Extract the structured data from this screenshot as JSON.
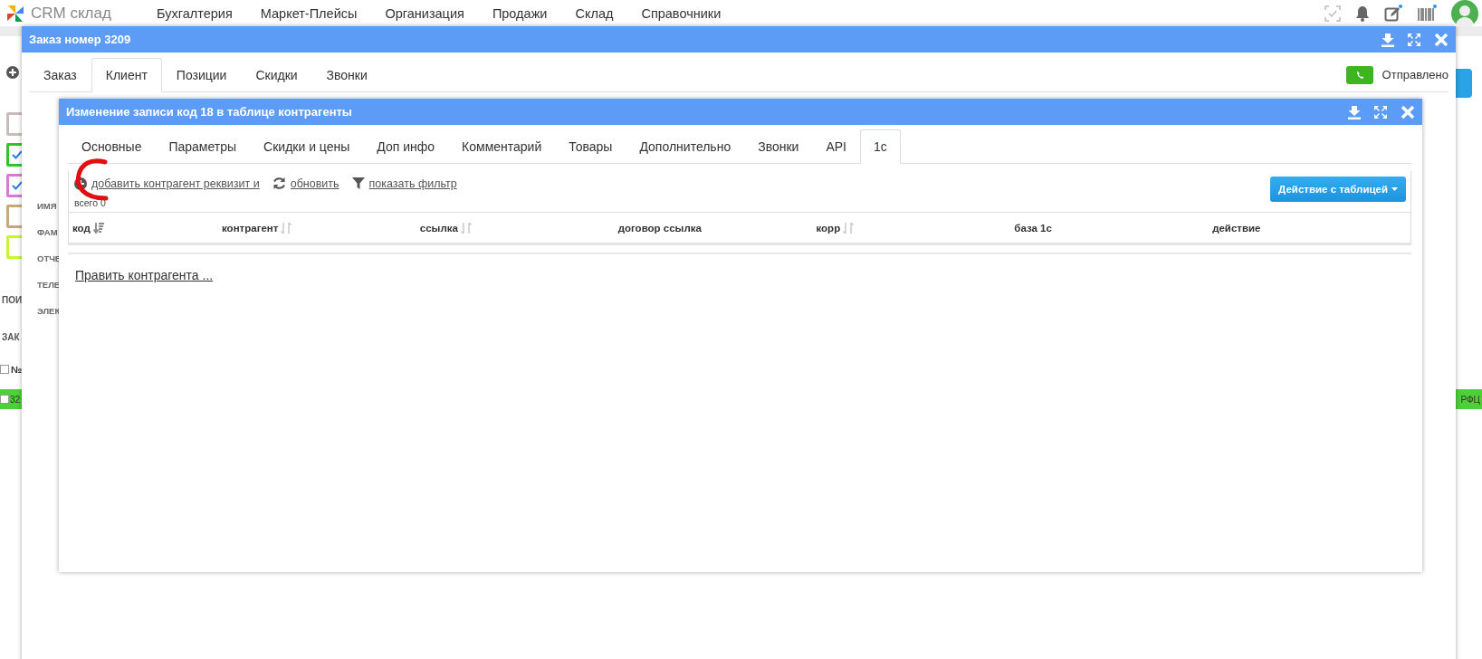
{
  "topbar": {
    "brand": "CRM склад",
    "menu": [
      "Бухгалтерия",
      "Маркет-Плейсы",
      "Организация",
      "Продажи",
      "Склад",
      "Справочники"
    ]
  },
  "background": {
    "checkboxes": [
      {
        "color": "#c9bcbc",
        "checked": false
      },
      {
        "color": "#2fc42f",
        "checked": true
      },
      {
        "color": "#d77ad7",
        "checked": true
      },
      {
        "color": "#c9a877",
        "checked": false
      },
      {
        "color": "#c8f52c",
        "checked": false
      }
    ],
    "labels": [
      "ПОИ",
      "ЗАК"
    ],
    "table_header": {
      "label": "№",
      "checked": false
    },
    "row": {
      "checked": false,
      "column_1": "32",
      "column_2": "РФЦ"
    }
  },
  "order_dialog": {
    "title": "Заказ номер 3209",
    "tabs": [
      {
        "label": "Заказ",
        "selected": false
      },
      {
        "label": "Клиент",
        "selected": true
      },
      {
        "label": "Позиции",
        "selected": false
      },
      {
        "label": "Скидки",
        "selected": false
      },
      {
        "label": "Звонки",
        "selected": false
      }
    ],
    "status": "Отправлено",
    "field_labels": [
      "ИМЯ",
      "ФАМ",
      "ОТЧЕ",
      "ТЕЛЕ",
      "ЭЛЕК"
    ]
  },
  "record_dialog": {
    "title": "Изменение записи код 18 в таблице контрагенты",
    "tabs": [
      {
        "label": "Основные",
        "selected": false
      },
      {
        "label": "Параметры",
        "selected": false
      },
      {
        "label": "Скидки и цены",
        "selected": false
      },
      {
        "label": "Доп инфо",
        "selected": false
      },
      {
        "label": "Комментарий",
        "selected": false
      },
      {
        "label": "Товары",
        "selected": false
      },
      {
        "label": "Дополнительно",
        "selected": false
      },
      {
        "label": "Звонки",
        "selected": false
      },
      {
        "label": "API",
        "selected": false
      },
      {
        "label": "1с",
        "selected": true
      }
    ],
    "toolbar": [
      {
        "kind": "add",
        "label": "добавить контрагент реквизит и"
      },
      {
        "kind": "refresh",
        "label": "обновить"
      },
      {
        "kind": "filter",
        "label": "показать фильтр"
      }
    ],
    "count": "всего 0",
    "action_button": "Действие с таблицей",
    "table": {
      "columns": [
        {
          "label": "код",
          "sorted": true
        },
        {
          "label": "контрагент",
          "sorted": false
        },
        {
          "label": "ссылка",
          "sorted": false
        },
        {
          "label": "договор ссылка"
        },
        {
          "label": "корр",
          "sorted": false
        },
        {
          "label": "база 1с"
        },
        {
          "label": "действие"
        }
      ]
    },
    "edit_link": "Править контрагента ..."
  }
}
